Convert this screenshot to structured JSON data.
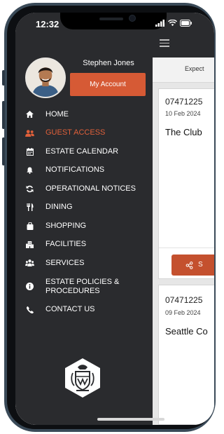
{
  "status_bar": {
    "time": "12:32"
  },
  "user": {
    "name": "Stephen Jones",
    "account_button": "My Account"
  },
  "menu": {
    "items": [
      {
        "label": "HOME",
        "icon": "home-icon",
        "active": false
      },
      {
        "label": "GUEST ACCESS",
        "icon": "users-icon",
        "active": true
      },
      {
        "label": "ESTATE CALENDAR",
        "icon": "calendar-icon",
        "active": false
      },
      {
        "label": "NOTIFICATIONS",
        "icon": "bell-icon",
        "active": false
      },
      {
        "label": "OPERATIONAL NOTICES",
        "icon": "sync-icon",
        "active": false
      },
      {
        "label": "DINING",
        "icon": "utensils-icon",
        "active": false
      },
      {
        "label": "SHOPPING",
        "icon": "shopping-bag-icon",
        "active": false
      },
      {
        "label": "FACILITIES",
        "icon": "building-icon",
        "active": false
      },
      {
        "label": "SERVICES",
        "icon": "services-icon",
        "active": false
      },
      {
        "label": "ESTATE POLICIES & PROCEDURES",
        "icon": "info-icon",
        "active": false
      },
      {
        "label": "CONTACT US",
        "icon": "phone-icon",
        "active": false
      }
    ]
  },
  "background": {
    "tab_label": "Expect",
    "cards": [
      {
        "phone": "07471225",
        "date": "10 Feb 2024",
        "place": "The Club",
        "share_label": "S"
      },
      {
        "phone": "07471225",
        "date": "09 Feb 2024",
        "place": "Seattle Co"
      }
    ]
  },
  "colors": {
    "accent": "#d65a35",
    "drawer_bg": "#2a2b2e",
    "active_text": "#e0603a"
  }
}
